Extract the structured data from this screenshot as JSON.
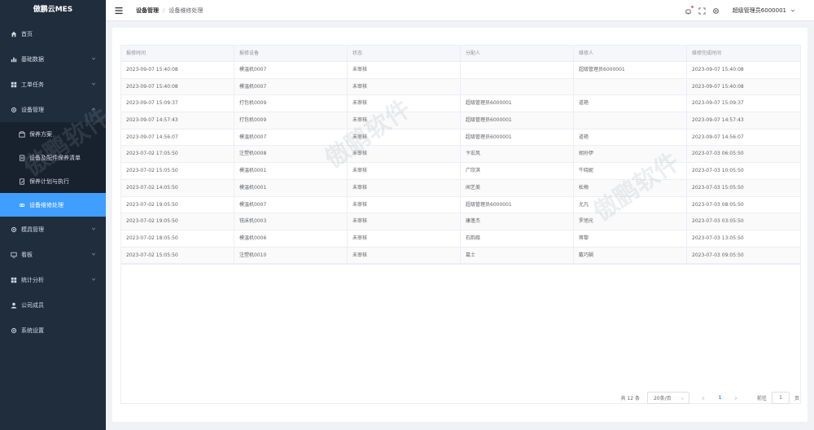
{
  "app": {
    "logo": "傲鹏云MES"
  },
  "sidebar": {
    "items": [
      {
        "label": "首页",
        "icon": "home-icon"
      },
      {
        "label": "基础数据",
        "icon": "bar-chart-icon",
        "expandable": true
      },
      {
        "label": "工单任务",
        "icon": "grid-icon",
        "expandable": true
      },
      {
        "label": "设备管理",
        "icon": "gear-icon",
        "expandable": true,
        "expanded": true
      }
    ],
    "subitems": [
      {
        "label": "保养方案",
        "icon": "box-icon"
      },
      {
        "label": "设备及配件保养清单",
        "icon": "document-icon"
      },
      {
        "label": "保养计划与执行",
        "icon": "document-edit-icon"
      },
      {
        "label": "设备维修处理",
        "icon": "link-icon",
        "active": true
      }
    ],
    "items_after": [
      {
        "label": "模具管理",
        "icon": "gear-icon",
        "expandable": true
      },
      {
        "label": "看板",
        "icon": "monitor-icon",
        "expandable": true
      },
      {
        "label": "统计分析",
        "icon": "grid-icon",
        "expandable": true
      },
      {
        "label": "公司成员",
        "icon": "user-icon"
      },
      {
        "label": "系统设置",
        "icon": "gear-icon"
      }
    ]
  },
  "header": {
    "breadcrumb_parent": "设备管理",
    "breadcrumb_sep": "/",
    "breadcrumb_current": "设备维修处理",
    "username": "超级管理员6000001"
  },
  "table": {
    "columns": [
      "报修时间",
      "报修设备",
      "状态",
      "分配人",
      "维修人",
      "维修完成时间"
    ],
    "rows": [
      [
        "2023-09-07 15:40:08",
        "模温机0007",
        "未审核",
        "",
        "超级管理员6000001",
        "2023-09-07 15:40:08"
      ],
      [
        "2023-09-07 15:40:08",
        "模温机0007",
        "未审核",
        "",
        "",
        "2023-09-07 15:40:08"
      ],
      [
        "2023-09-07 15:09:37",
        "打包机0009",
        "未审核",
        "超级管理员6000001",
        "道艳",
        "2023-09-07 15:09:37"
      ],
      [
        "2023-09-07 14:57:43",
        "打包机0009",
        "未审核",
        "超级管理员6000001",
        "",
        "2023-09-07 14:57:43"
      ],
      [
        "2023-09-07 14:56:07",
        "模温机0007",
        "未审核",
        "超级管理员6000001",
        "道艳",
        "2023-09-07 14:56:07"
      ],
      [
        "2023-07-02 17:05:50",
        "注塑机0008",
        "未审核",
        "卞宏风",
        "胡孙伊",
        "2023-07-03 06:05:50"
      ],
      [
        "2023-07-02 15:05:50",
        "模温机0001",
        "未审核",
        "广欣淇",
        "牛晓妮",
        "2023-07-03 10:05:50"
      ],
      [
        "2023-07-02 14:05:50",
        "模温机0001",
        "未审核",
        "闻艺美",
        "松梅",
        "2023-07-03 15:05:50"
      ],
      [
        "2023-07-02 19:05:50",
        "模温机0007",
        "未审核",
        "超级管理员6000001",
        "尤凡",
        "2023-07-03 08:05:50"
      ],
      [
        "2023-07-02 19:05:50",
        "铣床机0003",
        "未审核",
        "康蓬杰",
        "罗旭光",
        "2023-07-03 03:05:50"
      ],
      [
        "2023-07-02 18:05:50",
        "模温机0006",
        "未审核",
        "石韵葭",
        "蒋黎",
        "2023-07-03 13:05:50"
      ],
      [
        "2023-07-02 15:05:50",
        "注塑机0010",
        "未审核",
        "葛士",
        "戴巧娴",
        "2023-07-03 09:05:50"
      ]
    ]
  },
  "pagination": {
    "total": "共 12 条",
    "page_size": "20条/页",
    "current_page": "1",
    "goto_label": "前往",
    "goto_value": "1",
    "page_suffix": "页"
  },
  "watermark": "傲鹏软件",
  "colors": {
    "sidebar_bg": "#1f2d3d",
    "active": "#409eff",
    "badge": "#f56c6c"
  }
}
